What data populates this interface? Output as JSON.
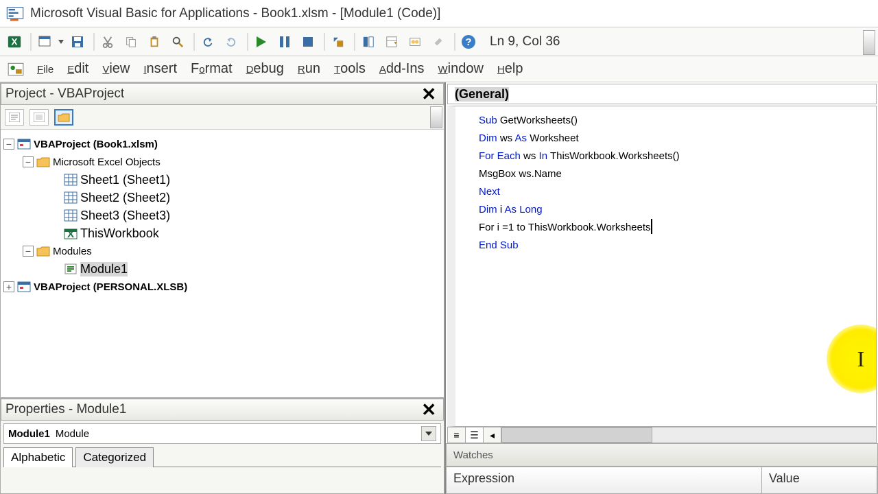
{
  "title": "Microsoft Visual Basic for Applications - Book1.xlsm - [Module1 (Code)]",
  "cursor_position": "Ln 9, Col 36",
  "menus": {
    "file": "File",
    "edit": "Edit",
    "view": "View",
    "insert": "Insert",
    "format": "Format",
    "debug": "Debug",
    "run": "Run",
    "tools": "Tools",
    "addins": "Add-Ins",
    "window": "Window",
    "help": "Help"
  },
  "project_pane": {
    "title": "Project - VBAProject",
    "root1": "VBAProject (Book1.xlsm)",
    "folder1": "Microsoft Excel Objects",
    "sheets": [
      "Sheet1 (Sheet1)",
      "Sheet2 (Sheet2)",
      "Sheet3 (Sheet3)"
    ],
    "thiswb": "ThisWorkbook",
    "folder2": "Modules",
    "module": "Module1",
    "root2": "VBAProject (PERSONAL.XLSB)"
  },
  "properties_pane": {
    "title": "Properties - Module1",
    "obj_name": "Module1",
    "obj_type": "Module",
    "tab1": "Alphabetic",
    "tab2": "Categorized"
  },
  "code_pane": {
    "dropdown": "(General)",
    "lines": {
      "l1_k": "Sub",
      "l1_r": " GetWorksheets()",
      "empty": "",
      "l3_a": "Dim",
      "l3_b": " ws ",
      "l3_c": "As",
      "l3_d": " Worksheet",
      "l4_a": "For Each",
      "l4_b": " ws ",
      "l4_c": "In",
      "l4_d": " ThisWorkbook.Worksheets()",
      "l5": "    MsgBox ws.Name",
      "l6": "Next",
      "l8_a": "Dim",
      "l8_b": " i ",
      "l8_c": "As Long",
      "l9": "For i =1 to ThisWorkbook.Worksheets",
      "l10": "End Sub"
    }
  },
  "watches": {
    "title": "Watches",
    "col1": "Expression",
    "col2": "Value"
  }
}
